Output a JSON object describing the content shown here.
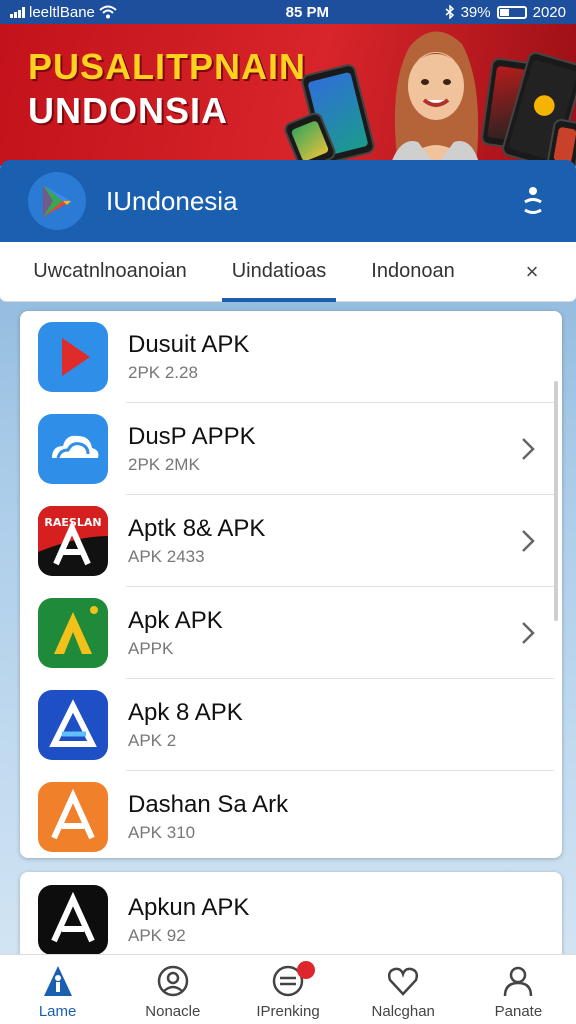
{
  "status_bar": {
    "carrier": "leeltlBane",
    "time": "85 PM",
    "battery": "39%",
    "extra": "2020",
    "battery_level": 0.35
  },
  "banner": {
    "title_line1": "PUSALITPNAIN",
    "title_line2": "UNDONSIA"
  },
  "header": {
    "title": "IUndonesia"
  },
  "tabs": [
    {
      "label": "Uwcatnlnoanoian"
    },
    {
      "label": "Uindatioas",
      "active": true
    },
    {
      "label": "Indonoan"
    }
  ],
  "tabs_close": "×",
  "apps": [
    {
      "name": "Dusuit APK",
      "sub": "2PK 2.28",
      "icon": "play-icon",
      "chevron": false
    },
    {
      "name": "DusP APPK",
      "sub": "2PK 2MK",
      "icon": "cloud-icon",
      "chevron": true
    },
    {
      "name": "Aptk 8& APK",
      "sub": "APK 2433",
      "icon": "apk-red-icon",
      "chevron": true
    },
    {
      "name": "Apk APK",
      "sub": "APPK",
      "icon": "apk-green-icon",
      "chevron": true
    },
    {
      "name": "Apk 8 APK",
      "sub": "APK 2",
      "icon": "apk-blue-icon",
      "chevron": false
    },
    {
      "name": "Dashan Sa Ark",
      "sub": "APK 310",
      "icon": "apk-orange-icon",
      "chevron": false
    }
  ],
  "apps_extra": {
    "name": "Apkun APK",
    "sub": "APK 92",
    "icon": "apk-black-icon"
  },
  "banner_mini": "RAESLAN",
  "nav": [
    {
      "label": "Lame",
      "icon": "home-icon",
      "active": true
    },
    {
      "label": "Nonacle",
      "icon": "face-icon"
    },
    {
      "label": "IPrenking",
      "icon": "chat-icon",
      "badge": true
    },
    {
      "label": "Nalcghan",
      "icon": "heart-icon"
    },
    {
      "label": "Panate",
      "icon": "user-icon"
    }
  ],
  "colors": {
    "primary": "#1a5fb0",
    "banner_red": "#d8252b",
    "banner_yellow": "#ffd21f",
    "badge_red": "#e0262d"
  }
}
